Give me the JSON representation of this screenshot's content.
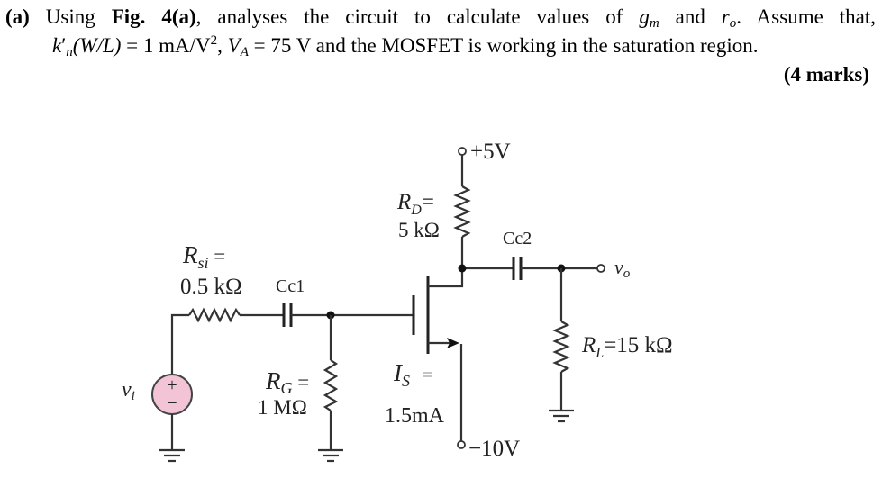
{
  "question": {
    "part_label": "(a)",
    "text_using": "Using",
    "fig_ref": "Fig. 4(a)",
    "text_mid": ", analyses the circuit to calculate values of",
    "gm_symbol": "g",
    "gm_sub": "m",
    "text_and": "and",
    "ro_symbol": "r",
    "ro_sub": "o",
    "text_assume": ". Assume that,",
    "kn_symbol": "k",
    "kn_prime": "′",
    "kn_sub": "n",
    "wl": "(W/L)",
    "kn_value": "= 1 mA/V",
    "kn_exp": "2",
    "va_sep": ", ",
    "va_symbol": "V",
    "va_sub": "A",
    "va_value": "=  75 V and the MOSFET is working in the saturation region.",
    "marks": "(4 marks)"
  },
  "circuit": {
    "vdd": "+5V",
    "vss": "−10V",
    "rd_symbol": "R",
    "rd_sub": "D",
    "rd_eq": "=",
    "rd_value": "5 kΩ",
    "rsi_symbol": "R",
    "rsi_sub": "si",
    "rsi_eq": " =",
    "rsi_value": "0.5 kΩ",
    "cc1": "Cc1",
    "cc2": "Cc2",
    "rg_symbol": "R",
    "rg_sub": "G",
    "rg_eq": " =",
    "rg_value": "1 MΩ",
    "is_symbol": "I",
    "is_sub": "S",
    "is_eq": "=",
    "is_value": "1.5mA",
    "rl_symbol": "R",
    "rl_sub": "L",
    "rl_value": "=15 kΩ",
    "vi_symbol": "v",
    "vi_sub": "i",
    "vo_symbol": "v",
    "vo_sub": "o",
    "source_plus": "+",
    "source_minus": "−",
    "colors": {
      "source_fill": "#f2c4d6",
      "label_blue": "#1f3864",
      "wire": "#333333"
    }
  }
}
